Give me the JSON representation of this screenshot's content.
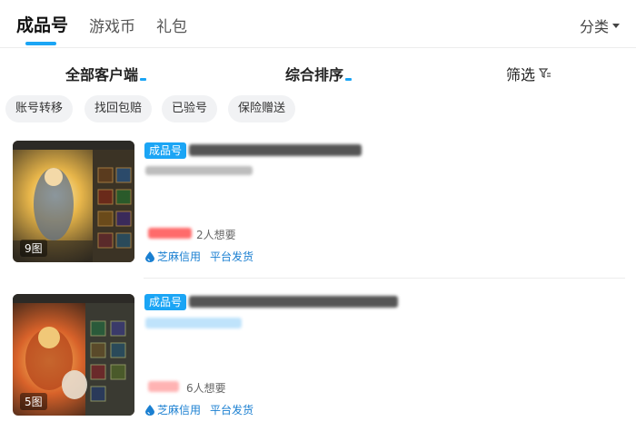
{
  "tabs": [
    {
      "label": "成品号",
      "active": true
    },
    {
      "label": "游戏币",
      "active": false
    },
    {
      "label": "礼包",
      "active": false
    }
  ],
  "category_label": "分类",
  "sort": {
    "client_label": "全部客户端",
    "order_label": "综合排序",
    "filter_label": "筛选"
  },
  "chips": [
    "账号转移",
    "找回包赔",
    "已验号",
    "保险赠送"
  ],
  "items": [
    {
      "image_count": "9图",
      "badge": "成品号",
      "wants": "2人想要",
      "tags": [
        "芝麻信用",
        "平台发货"
      ]
    },
    {
      "image_count": "5图",
      "badge": "成品号",
      "wants": "6人想要",
      "tags": [
        "芝麻信用",
        "平台发货"
      ]
    }
  ],
  "colors": {
    "accent": "#1ba5f5",
    "tag_text": "#1a7fd1",
    "price": "#ff5a5a"
  },
  "icons": [
    "caret-down-icon",
    "filter-icon",
    "water-drop-icon"
  ]
}
